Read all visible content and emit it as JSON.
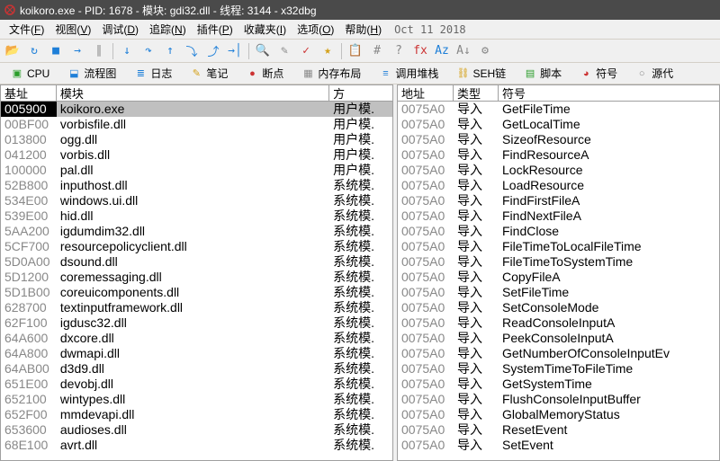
{
  "title": "koikoro.exe - PID: 1678 - 模块: gdi32.dll - 线程: 3144 - x32dbg",
  "menus": [
    {
      "label": "文件",
      "key": "F"
    },
    {
      "label": "视图",
      "key": "V"
    },
    {
      "label": "调试",
      "key": "D"
    },
    {
      "label": "追踪",
      "key": "N"
    },
    {
      "label": "插件",
      "key": "P"
    },
    {
      "label": "收藏夹",
      "key": "I"
    },
    {
      "label": "选项",
      "key": "O"
    },
    {
      "label": "帮助",
      "key": "H"
    }
  ],
  "menu_date": "Oct 11 2018",
  "toolbar_icons": [
    {
      "name": "open-icon",
      "glyph": "📂",
      "color": "#d4a017"
    },
    {
      "name": "restart-icon",
      "glyph": "↻",
      "color": "#1e7fd8"
    },
    {
      "name": "stop-icon",
      "glyph": "■",
      "color": "#1e7fd8"
    },
    {
      "name": "run-icon",
      "glyph": "→",
      "color": "#1e7fd8"
    },
    {
      "name": "pause-icon",
      "glyph": "∥",
      "color": "#888"
    },
    {
      "name": "sep"
    },
    {
      "name": "step-into-icon",
      "glyph": "↓",
      "color": "#1e7fd8"
    },
    {
      "name": "step-over-icon",
      "glyph": "↷",
      "color": "#1e7fd8"
    },
    {
      "name": "step-out-icon",
      "glyph": "↑",
      "color": "#1e7fd8"
    },
    {
      "name": "step-over2-icon",
      "glyph": "⤵",
      "color": "#1e7fd8"
    },
    {
      "name": "step-ret-icon",
      "glyph": "⤴",
      "color": "#1e7fd8"
    },
    {
      "name": "run-to-icon",
      "glyph": "→│",
      "color": "#1e7fd8"
    },
    {
      "name": "sep"
    },
    {
      "name": "search-icon",
      "glyph": "🔍",
      "color": "#888"
    },
    {
      "name": "patch-icon",
      "glyph": "✎",
      "color": "#888"
    },
    {
      "name": "comment-icon",
      "glyph": "✓",
      "color": "#c33"
    },
    {
      "name": "star-icon",
      "glyph": "★",
      "color": "#d4a017"
    },
    {
      "name": "sep"
    },
    {
      "name": "script-icon",
      "glyph": "📋",
      "color": "#888"
    },
    {
      "name": "hash-icon",
      "glyph": "#",
      "color": "#888"
    },
    {
      "name": "calc-icon",
      "glyph": "?",
      "color": "#888"
    },
    {
      "name": "fx-icon",
      "glyph": "fx",
      "color": "#c33"
    },
    {
      "name": "az-icon",
      "glyph": "Az",
      "color": "#1e7fd8"
    },
    {
      "name": "font-icon",
      "glyph": "A↓",
      "color": "#888"
    },
    {
      "name": "gear-icon",
      "glyph": "⚙",
      "color": "#888"
    }
  ],
  "tabs": [
    {
      "name": "cpu",
      "label": "CPU",
      "icon": "▣",
      "icolor": "#2a9d2a"
    },
    {
      "name": "flowchart",
      "label": "流程图",
      "icon": "⬓",
      "icolor": "#1e7fd8"
    },
    {
      "name": "log",
      "label": "日志",
      "icon": "≣",
      "icolor": "#1e7fd8"
    },
    {
      "name": "notes",
      "label": "笔记",
      "icon": "✎",
      "icolor": "#d4a017"
    },
    {
      "name": "breakpoints",
      "label": "断点",
      "icon": "●",
      "icolor": "#c33"
    },
    {
      "name": "memmap",
      "label": "内存布局",
      "icon": "▦",
      "icolor": "#888"
    },
    {
      "name": "callstack",
      "label": "调用堆栈",
      "icon": "≡",
      "icolor": "#1e7fd8"
    },
    {
      "name": "seh",
      "label": "SEH链",
      "icon": "⛓",
      "icolor": "#d4a017"
    },
    {
      "name": "script",
      "label": "脚本",
      "icon": "▤",
      "icolor": "#2a9d2a"
    },
    {
      "name": "symbols",
      "label": "符号",
      "icon": "◕",
      "icolor": "#c33"
    },
    {
      "name": "source",
      "label": "源代",
      "icon": "○",
      "icolor": "#888"
    }
  ],
  "left": {
    "headers": [
      "基址",
      "模块",
      "方"
    ],
    "rows": [
      {
        "a": "005900",
        "m": "koikoro.exe",
        "t": "用户模.",
        "sel": true
      },
      {
        "a": "00BF00",
        "m": "vorbisfile.dll",
        "t": "用户模."
      },
      {
        "a": "013800",
        "m": "ogg.dll",
        "t": "用户模."
      },
      {
        "a": "041200",
        "m": "vorbis.dll",
        "t": "用户模."
      },
      {
        "a": "100000",
        "m": "pal.dll",
        "t": "用户模."
      },
      {
        "a": "52B800",
        "m": "inputhost.dll",
        "t": "系统模."
      },
      {
        "a": "534E00",
        "m": "windows.ui.dll",
        "t": "系统模."
      },
      {
        "a": "539E00",
        "m": "hid.dll",
        "t": "系统模."
      },
      {
        "a": "5AA200",
        "m": "igdumdim32.dll",
        "t": "系统模."
      },
      {
        "a": "5CF700",
        "m": "resourcepolicyclient.dll",
        "t": "系统模."
      },
      {
        "a": "5D0A00",
        "m": "dsound.dll",
        "t": "系统模."
      },
      {
        "a": "5D1200",
        "m": "coremessaging.dll",
        "t": "系统模."
      },
      {
        "a": "5D1B00",
        "m": "coreuicomponents.dll",
        "t": "系统模."
      },
      {
        "a": "628700",
        "m": "textinputframework.dll",
        "t": "系统模."
      },
      {
        "a": "62F100",
        "m": "igdusc32.dll",
        "t": "系统模."
      },
      {
        "a": "64A600",
        "m": "dxcore.dll",
        "t": "系统模."
      },
      {
        "a": "64A800",
        "m": "dwmapi.dll",
        "t": "系统模."
      },
      {
        "a": "64AB00",
        "m": "d3d9.dll",
        "t": "系统模."
      },
      {
        "a": "651E00",
        "m": "devobj.dll",
        "t": "系统模."
      },
      {
        "a": "652100",
        "m": "wintypes.dll",
        "t": "系统模."
      },
      {
        "a": "652F00",
        "m": "mmdevapi.dll",
        "t": "系统模."
      },
      {
        "a": "653600",
        "m": "audioses.dll",
        "t": "系统模."
      },
      {
        "a": "68E100",
        "m": "avrt.dll",
        "t": "系统模."
      }
    ]
  },
  "right": {
    "headers": [
      "地址",
      "类型",
      "符号"
    ],
    "rows": [
      {
        "a": "0075A0",
        "t": "导入",
        "s": "GetFileTime"
      },
      {
        "a": "0075A0",
        "t": "导入",
        "s": "GetLocalTime"
      },
      {
        "a": "0075A0",
        "t": "导入",
        "s": "SizeofResource"
      },
      {
        "a": "0075A0",
        "t": "导入",
        "s": "FindResourceA"
      },
      {
        "a": "0075A0",
        "t": "导入",
        "s": "LockResource"
      },
      {
        "a": "0075A0",
        "t": "导入",
        "s": "LoadResource"
      },
      {
        "a": "0075A0",
        "t": "导入",
        "s": "FindFirstFileA"
      },
      {
        "a": "0075A0",
        "t": "导入",
        "s": "FindNextFileA"
      },
      {
        "a": "0075A0",
        "t": "导入",
        "s": "FindClose"
      },
      {
        "a": "0075A0",
        "t": "导入",
        "s": "FileTimeToLocalFileTime"
      },
      {
        "a": "0075A0",
        "t": "导入",
        "s": "FileTimeToSystemTime"
      },
      {
        "a": "0075A0",
        "t": "导入",
        "s": "CopyFileA"
      },
      {
        "a": "0075A0",
        "t": "导入",
        "s": "SetFileTime"
      },
      {
        "a": "0075A0",
        "t": "导入",
        "s": "SetConsoleMode"
      },
      {
        "a": "0075A0",
        "t": "导入",
        "s": "ReadConsoleInputA"
      },
      {
        "a": "0075A0",
        "t": "导入",
        "s": "PeekConsoleInputA"
      },
      {
        "a": "0075A0",
        "t": "导入",
        "s": "GetNumberOfConsoleInputEv"
      },
      {
        "a": "0075A0",
        "t": "导入",
        "s": "SystemTimeToFileTime"
      },
      {
        "a": "0075A0",
        "t": "导入",
        "s": "GetSystemTime"
      },
      {
        "a": "0075A0",
        "t": "导入",
        "s": "FlushConsoleInputBuffer"
      },
      {
        "a": "0075A0",
        "t": "导入",
        "s": "GlobalMemoryStatus"
      },
      {
        "a": "0075A0",
        "t": "导入",
        "s": "ResetEvent"
      },
      {
        "a": "0075A0",
        "t": "导入",
        "s": "SetEvent"
      }
    ]
  }
}
